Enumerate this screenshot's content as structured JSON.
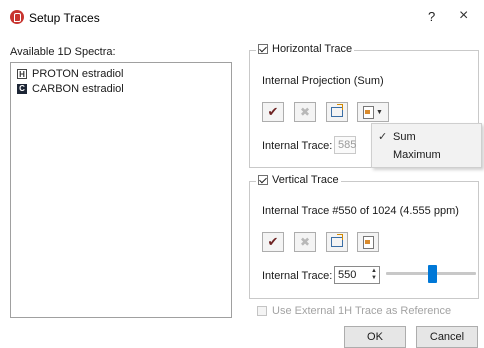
{
  "window": {
    "title": "Setup Traces",
    "help": "?",
    "close": "×"
  },
  "spectra": {
    "label": "Available 1D Spectra:",
    "items": [
      {
        "label": "PROTON estradiol",
        "icon": "proton-spectrum-icon",
        "badge": "H"
      },
      {
        "label": "CARBON estradiol",
        "icon": "carbon-spectrum-icon",
        "badge": "C"
      }
    ]
  },
  "horizontal": {
    "legend": "Horizontal Trace",
    "checked": true,
    "description": "Internal Projection (Sum)",
    "trace_label": "Internal Trace:",
    "trace_value": "585",
    "trace_enabled": false
  },
  "dropdown": {
    "items": [
      {
        "label": "Sum",
        "checked": true
      },
      {
        "label": "Maximum",
        "checked": false
      }
    ]
  },
  "vertical": {
    "legend": "Vertical Trace",
    "checked": true,
    "description": "Internal Trace #550 of 1024 (4.555 ppm)",
    "trace_label": "Internal Trace:",
    "trace_value": "550",
    "slider_value": 550,
    "slider_max": 1024
  },
  "external_ref": {
    "label": "Use External 1H Trace as Reference",
    "checked": false,
    "enabled": false
  },
  "buttons": {
    "ok": "OK",
    "cancel": "Cancel"
  },
  "colors": {
    "accent": "#0078d7",
    "app_icon": "#c8342f",
    "apply_check": "#6e2323"
  }
}
